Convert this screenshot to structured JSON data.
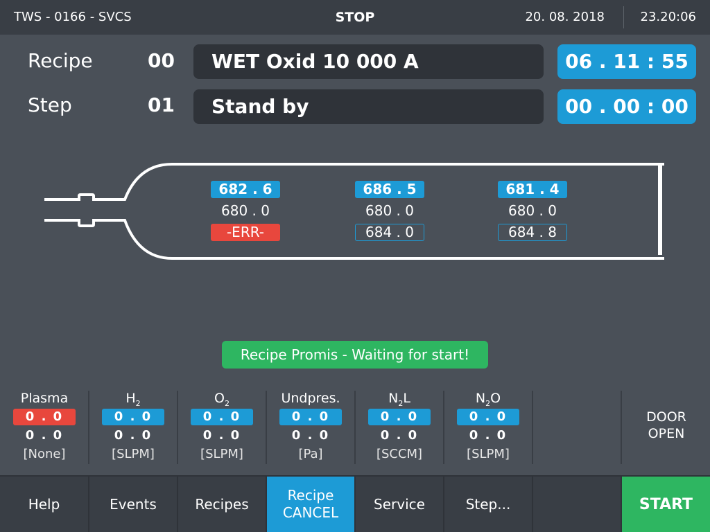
{
  "header": {
    "system": "TWS - 0166 - SVCS",
    "state": "STOP",
    "date": "20. 08. 2018",
    "time": "23.20:06"
  },
  "recipe": {
    "label": "Recipe",
    "number": "00",
    "name": "WET Oxid 10 000 A",
    "timer": "06 . 11 : 55"
  },
  "step": {
    "label": "Step",
    "number": "01",
    "name": "Stand by",
    "timer": "00 . 00 : 00"
  },
  "zones": [
    {
      "actual": "682 . 6",
      "setpoint": "680 . 0",
      "third": "-ERR-"
    },
    {
      "actual": "686 . 5",
      "setpoint": "680 . 0",
      "third": "684 . 0"
    },
    {
      "actual": "681 . 4",
      "setpoint": "680 . 0",
      "third": "684 . 8"
    }
  ],
  "status_message": "Recipe Promis - Waiting for start!",
  "gases": [
    {
      "name": "Plasma",
      "actual": "0 . 0",
      "setpoint": "0 . 0",
      "unit": "[None]"
    },
    {
      "name_main": "H",
      "name_sub": "2",
      "name_tail": "",
      "actual": "0 . 0",
      "setpoint": "0 . 0",
      "unit": "[SLPM]"
    },
    {
      "name_main": "O",
      "name_sub": "2",
      "name_tail": "",
      "actual": "0 . 0",
      "setpoint": "0 . 0",
      "unit": "[SLPM]"
    },
    {
      "name": "Undpres.",
      "actual": "0 . 0",
      "setpoint": "0 . 0",
      "unit": "[Pa]"
    },
    {
      "name_main": "N",
      "name_sub": "2",
      "name_tail": "L",
      "actual": "0 . 0",
      "setpoint": "0 . 0",
      "unit": "[SCCM]"
    },
    {
      "name_main": "N",
      "name_sub": "2",
      "name_tail": "O",
      "actual": "0 . 0",
      "setpoint": "0 . 0",
      "unit": "[SLPM]"
    }
  ],
  "door": {
    "line1": "DOOR",
    "line2": "OPEN"
  },
  "buttons": {
    "help": "Help",
    "events": "Events",
    "recipes": "Recipes",
    "recipe_cancel_1": "Recipe",
    "recipe_cancel_2": "CANCEL",
    "service": "Service",
    "step": "Step...",
    "start": "START"
  },
  "colors": {
    "background": "#4a5058",
    "bar": "#393e45",
    "accent_blue": "#1d9bd6",
    "error_red": "#e8473d",
    "ok_green": "#2eb661"
  }
}
